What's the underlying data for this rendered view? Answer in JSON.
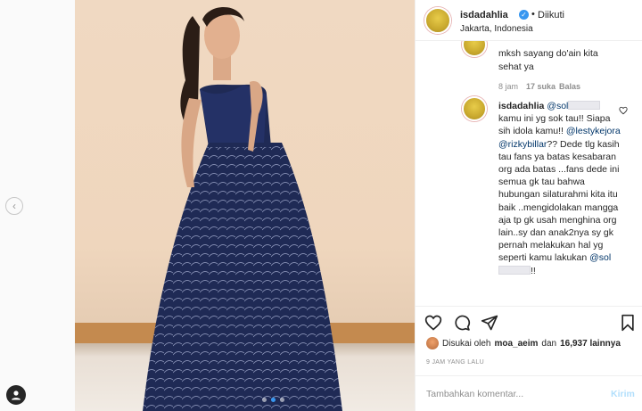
{
  "header": {
    "username": "isdadahlia",
    "separator": "•",
    "follow_status": "Diikuti",
    "location": "Jakarta, Indonesia"
  },
  "comments": [
    {
      "text": "mksh sayang do'ain kita sehat ya",
      "age": "8 jam",
      "likes": "17 suka",
      "reply": "Balas"
    },
    {
      "username": "isdadahlia",
      "mention1": "@sol",
      "line1": "kamu ini yg sok tau!! Siapa sih idola kamu!!",
      "mention2": "@lestykejora",
      "mention3": "@rizkybillar",
      "body": "?? Dede tlg kasih tau fans ya batas kesabaran org ada batas ...fans dede ini semua gk tau bahwa hubungan silaturahmi kita itu baik ..mengidolakan mangga aja tp gk usah menghina org lain..sy dan anak2nya sy gk pernah melakukan hal yg seperti kamu lakukan",
      "mention4": "@sol",
      "end": "!!"
    }
  ],
  "likes": {
    "prefix": "Disukai oleh",
    "user": "moa_aeim",
    "joiner": "dan",
    "count": "16,937 lainnya"
  },
  "timestamp": "9 JAM YANG LALU",
  "composer": {
    "placeholder": "Tambahkan komentar...",
    "send": "Kirim"
  },
  "colors": {
    "verified": "#3897f0",
    "mention": "#003569",
    "send_disabled": "#b2dffc",
    "dress": "#1f2a55"
  },
  "icons": [
    "verified-icon",
    "heart-icon",
    "comment-icon",
    "share-icon",
    "bookmark-icon",
    "chevron-left-icon",
    "profile-icon"
  ],
  "carousel": {
    "count": 3,
    "active_index": 1
  }
}
